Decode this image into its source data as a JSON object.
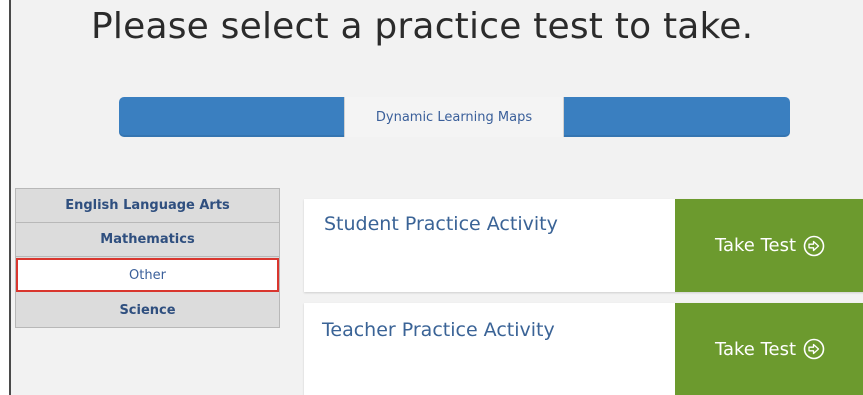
{
  "header": {
    "title": "Please select a practice test to take."
  },
  "program_tabs": {
    "active_label": "Dynamic Learning Maps"
  },
  "subjects": {
    "items": [
      {
        "label": "English Language Arts",
        "selected": false
      },
      {
        "label": "Mathematics",
        "selected": false
      },
      {
        "label": "Other",
        "selected": true
      },
      {
        "label": "Science",
        "selected": false
      }
    ],
    "selected_border_color": "#d9362e"
  },
  "activities": [
    {
      "title": "Student Practice Activity",
      "button_label": "Take Test",
      "button_icon": "circle-arrow-right-icon"
    },
    {
      "title": "Teacher Practice Activity",
      "button_label": "Take Test",
      "button_icon": "circle-arrow-right-icon"
    }
  ],
  "colors": {
    "program_bar": "#3a7fc0",
    "take_test_button": "#6c9a2e",
    "link_text": "#3a6396"
  }
}
